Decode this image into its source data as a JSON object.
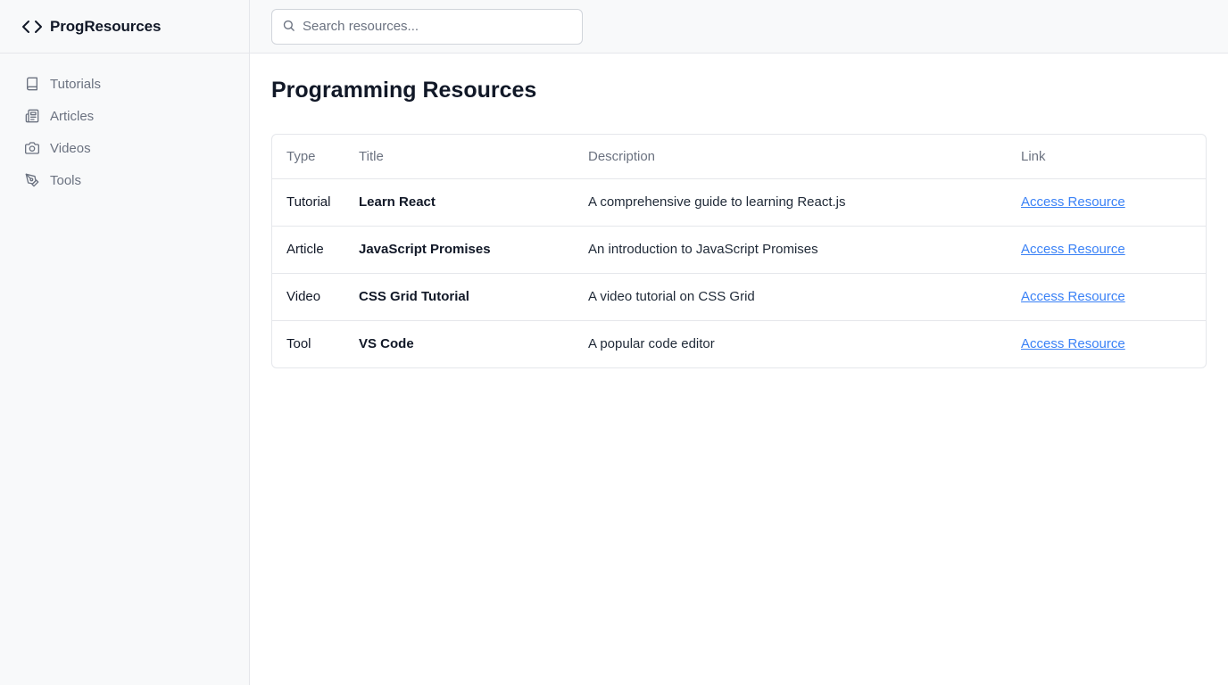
{
  "brand": {
    "name": "ProgResources",
    "icon": "code-icon"
  },
  "sidebar": {
    "items": [
      {
        "label": "Tutorials",
        "icon": "book-icon"
      },
      {
        "label": "Articles",
        "icon": "newspaper-icon"
      },
      {
        "label": "Videos",
        "icon": "camera-icon"
      },
      {
        "label": "Tools",
        "icon": "pen-tool-icon"
      }
    ]
  },
  "search": {
    "placeholder": "Search resources...",
    "value": ""
  },
  "main": {
    "title": "Programming Resources"
  },
  "table": {
    "headers": {
      "type": "Type",
      "title": "Title",
      "description": "Description",
      "link": "Link"
    },
    "rows": [
      {
        "type": "Tutorial",
        "title": "Learn React",
        "description": "A comprehensive guide to learning React.js",
        "link": "Access Resource"
      },
      {
        "type": "Article",
        "title": "JavaScript Promises",
        "description": "An introduction to JavaScript Promises",
        "link": "Access Resource"
      },
      {
        "type": "Video",
        "title": "CSS Grid Tutorial",
        "description": "A video tutorial on CSS Grid",
        "link": "Access Resource"
      },
      {
        "type": "Tool",
        "title": "VS Code",
        "description": "A popular code editor",
        "link": "Access Resource"
      }
    ]
  },
  "colors": {
    "accent_link": "#3b82f6",
    "sidebar_bg": "#f8f9fa",
    "border": "#e5e7eb",
    "muted_text": "#6b7280"
  }
}
